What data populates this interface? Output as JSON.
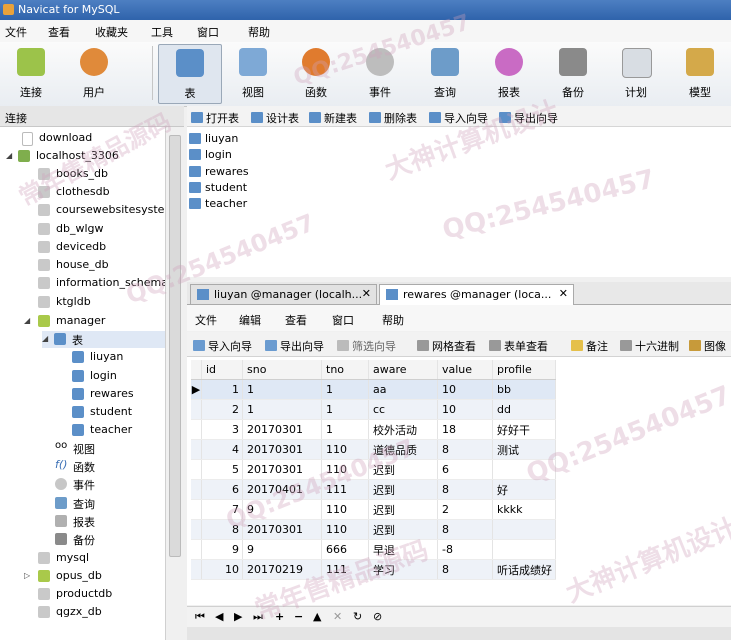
{
  "window": {
    "title": "Navicat for MySQL"
  },
  "menubar": {
    "items": [
      "文件",
      "查看",
      "收藏夹",
      "工具",
      "窗口",
      "帮助"
    ]
  },
  "toolbar": {
    "connect": "连接",
    "user": "用户",
    "table": "表",
    "view": "视图",
    "function": "函数",
    "event": "事件",
    "query": "查询",
    "report": "报表",
    "backup": "备份",
    "schedule": "计划",
    "model": "模型"
  },
  "connections": {
    "header": "连接",
    "download": "download",
    "localhost": "localhost_3306",
    "dbs_top": [
      "books_db",
      "clothesdb",
      "coursewebsitesyster",
      "db_wlgw",
      "devicedb",
      "house_db",
      "information_schema",
      "ktgldb"
    ],
    "manager": "manager",
    "tables_label": "表",
    "tables": [
      "liuyan",
      "login",
      "rewares",
      "student",
      "teacher"
    ],
    "others": {
      "view": "视图",
      "function": "函数",
      "event": "事件",
      "query": "查询",
      "report": "报表",
      "backup": "备份"
    },
    "dbs_bottom": [
      "mysql",
      "opus_db",
      "productdb",
      "qgzx_db"
    ]
  },
  "objbar": {
    "open": "打开表",
    "design": "设计表",
    "new": "新建表",
    "delete": "删除表",
    "import": "导入向导",
    "export": "导出向导"
  },
  "tablelist": [
    "liuyan",
    "login",
    "rewares",
    "student",
    "teacher"
  ],
  "tabs": {
    "tab1": "liuyan @manager (localh...",
    "tab2": "rewares @manager (loca..."
  },
  "datamenu": {
    "file": "文件",
    "edit": "编辑",
    "view": "查看",
    "window": "窗口",
    "help": "帮助"
  },
  "datatools": {
    "import": "导入向导",
    "export": "导出向导",
    "filter": "筛选向导",
    "grid": "网格查看",
    "form": "表单查看",
    "memo": "备注",
    "hex": "十六进制",
    "image": "图像"
  },
  "grid": {
    "columns": [
      "id",
      "sno",
      "tno",
      "aware",
      "value",
      "profile"
    ],
    "rows": [
      [
        "1",
        "1",
        "1",
        "aa",
        "10",
        "bb"
      ],
      [
        "2",
        "1",
        "1",
        "cc",
        "10",
        "dd"
      ],
      [
        "3",
        "20170301",
        "1",
        "校外活动",
        "18",
        "好好干"
      ],
      [
        "4",
        "20170301",
        "110",
        "道德品质",
        "8",
        "测试"
      ],
      [
        "5",
        "20170301",
        "110",
        "迟到",
        "6",
        ""
      ],
      [
        "6",
        "20170401",
        "111",
        "迟到",
        "8",
        "好"
      ],
      [
        "7",
        "9",
        "110",
        "迟到",
        "2",
        "kkkk"
      ],
      [
        "8",
        "20170301",
        "110",
        "迟到",
        "8",
        ""
      ],
      [
        "9",
        "9",
        "666",
        "早退",
        "-8",
        ""
      ],
      [
        "10",
        "20170219",
        "111",
        "学习",
        "8",
        "听话成绩好"
      ]
    ]
  },
  "navbar": {
    "first": "⏮",
    "prev": "◀",
    "next": "▶",
    "last": "⏭",
    "add": "+",
    "delete": "−",
    "up": "▲",
    "cancel": "✕",
    "refresh": "↻",
    "stop": "⊘"
  },
  "watermark": {
    "qq": "QQ:254540457",
    "cn1": "大神计算机设计",
    "cn2": "常年售精品源码"
  }
}
